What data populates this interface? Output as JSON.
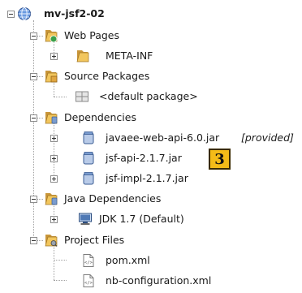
{
  "tree": {
    "project": {
      "label": "mv-jsf2-02",
      "icon": "globe-project-icon"
    },
    "web_pages": {
      "label": "Web Pages",
      "icon": "folder-web-icon",
      "children": [
        {
          "label": "META-INF",
          "icon": "folder-icon"
        }
      ]
    },
    "source_packages": {
      "label": "Source Packages",
      "icon": "folder-package-icon",
      "children": [
        {
          "label": "<default package>",
          "icon": "package-icon"
        }
      ]
    },
    "dependencies": {
      "label": "Dependencies",
      "icon": "folder-jar-icon",
      "children": [
        {
          "label": "javaee-web-api-6.0.jar",
          "note": "[provided]",
          "icon": "jar-icon"
        },
        {
          "label": "jsf-api-2.1.7.jar",
          "icon": "jar-icon"
        },
        {
          "label": "jsf-impl-2.1.7.jar",
          "icon": "jar-icon"
        }
      ]
    },
    "java_dependencies": {
      "label": "Java Dependencies",
      "icon": "folder-jar-icon",
      "children": [
        {
          "label": "JDK 1.7 (Default)",
          "icon": "jdk-icon"
        }
      ]
    },
    "project_files": {
      "label": "Project Files",
      "icon": "folder-config-icon",
      "children": [
        {
          "label": "pom.xml",
          "icon": "xml-file-icon"
        },
        {
          "label": "nb-configuration.xml",
          "icon": "xml-file-icon"
        }
      ]
    }
  },
  "callout": {
    "number": "3"
  },
  "colors": {
    "folder": "#e8b64c",
    "callout": "#f4bb18",
    "jar": "#7a9ccf"
  }
}
